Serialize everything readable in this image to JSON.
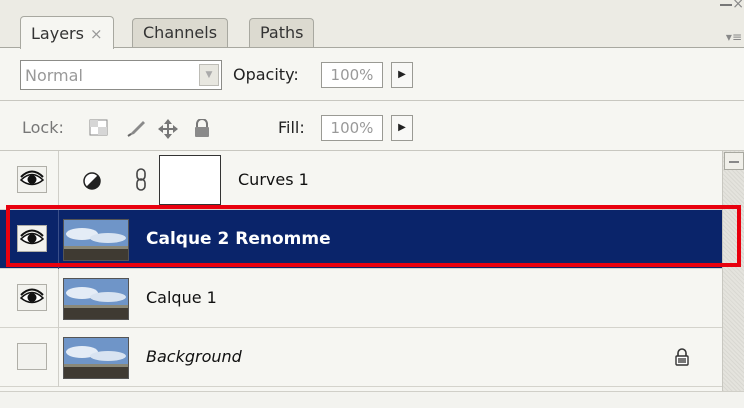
{
  "tabs": [
    {
      "label": "Layers",
      "close": "×"
    },
    {
      "label": "Channels"
    },
    {
      "label": "Paths"
    }
  ],
  "blend_mode": "Normal",
  "opacity": {
    "label": "Opacity:",
    "value": "100%"
  },
  "lock": {
    "label": "Lock:"
  },
  "fill": {
    "label": "Fill:",
    "value": "100%"
  },
  "layers": [
    {
      "name": "Curves 1",
      "visible": true,
      "type": "adjustment"
    },
    {
      "name": "Calque 2 Renomme",
      "visible": true,
      "selected": true
    },
    {
      "name": "Calque 1",
      "visible": true
    },
    {
      "name": "Background",
      "visible": false,
      "locked": true,
      "italic": true
    }
  ],
  "colors": {
    "selection": "#0a246a",
    "highlight_frame": "#e8000e",
    "panel_bg": "#f6f6f2"
  },
  "icons": {
    "eye": "eye-icon",
    "adjustment": "adjustment-layer-icon",
    "chain": "link-chain-icon",
    "lock": "lock-icon"
  }
}
